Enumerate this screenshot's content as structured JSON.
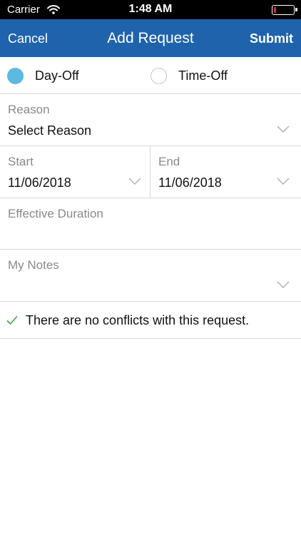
{
  "status_bar": {
    "carrier": "Carrier",
    "time": "1:48 AM",
    "battery_level": 0.1
  },
  "nav": {
    "cancel_label": "Cancel",
    "title": "Add Request",
    "submit_label": "Submit"
  },
  "request_type": {
    "options": [
      {
        "label": "Day-Off",
        "selected": true
      },
      {
        "label": "Time-Off",
        "selected": false
      }
    ]
  },
  "reason": {
    "label": "Reason",
    "value": "Select Reason"
  },
  "start": {
    "label": "Start",
    "value": "11/06/2018"
  },
  "end": {
    "label": "End",
    "value": "11/06/2018"
  },
  "duration": {
    "label": "Effective Duration",
    "value": ""
  },
  "notes": {
    "label": "My Notes",
    "value": ""
  },
  "conflict": {
    "message": "There are no conflicts with this request.",
    "icon": "checkmark-icon"
  },
  "colors": {
    "nav_bar": "#1f63ad",
    "radio_selected": "#5cb9df",
    "check": "#3aa34a",
    "battery_low": "#e8263a"
  }
}
